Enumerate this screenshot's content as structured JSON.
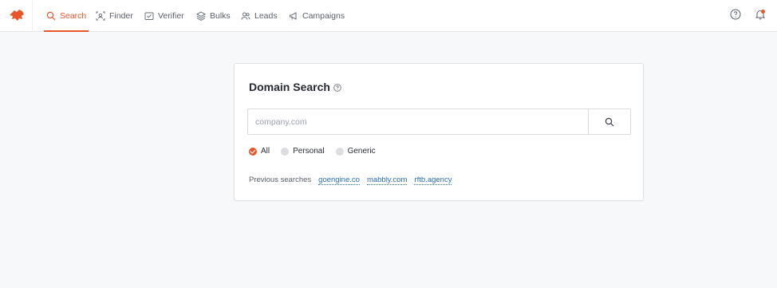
{
  "nav": {
    "items": [
      {
        "label": "Search",
        "icon": "search-icon",
        "active": true
      },
      {
        "label": "Finder",
        "icon": "finder-icon",
        "active": false
      },
      {
        "label": "Verifier",
        "icon": "verifier-icon",
        "active": false
      },
      {
        "label": "Bulks",
        "icon": "layers-icon",
        "active": false
      },
      {
        "label": "Leads",
        "icon": "users-icon",
        "active": false
      },
      {
        "label": "Campaigns",
        "icon": "megaphone-icon",
        "active": false
      }
    ],
    "accent_color": "#e8572a"
  },
  "card": {
    "title": "Domain Search",
    "search": {
      "placeholder": "company.com",
      "value": ""
    },
    "filters": [
      {
        "label": "All",
        "checked": true
      },
      {
        "label": "Personal",
        "checked": false
      },
      {
        "label": "Generic",
        "checked": false
      }
    ],
    "previous_label": "Previous searches",
    "previous": [
      "goengine.co",
      "mabbly.com",
      "rftb.agency"
    ]
  }
}
